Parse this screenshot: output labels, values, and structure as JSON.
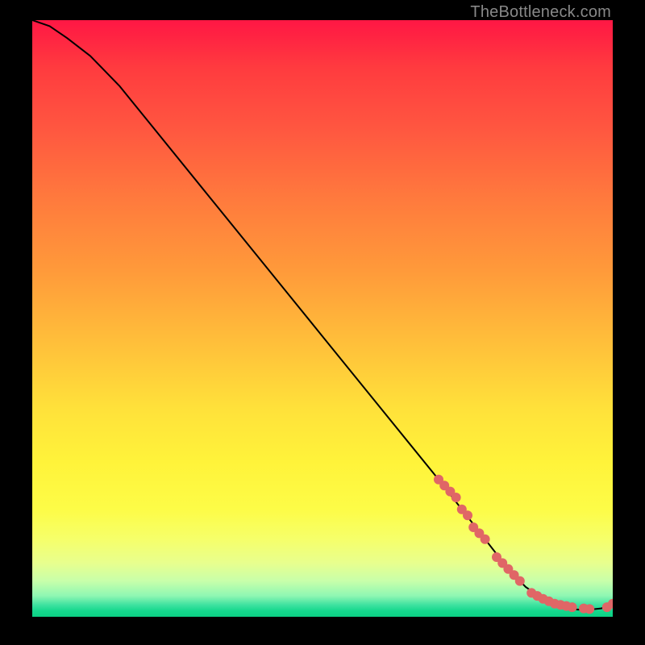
{
  "watermark": "TheBottleneck.com",
  "chart_data": {
    "type": "line",
    "title": "",
    "xlabel": "",
    "ylabel": "",
    "xlim": [
      0,
      100
    ],
    "ylim": [
      0,
      100
    ],
    "grid": false,
    "series": [
      {
        "name": "curve",
        "style": "line",
        "color": "#000000",
        "x": [
          0,
          3,
          6,
          10,
          15,
          20,
          30,
          40,
          50,
          60,
          70,
          78,
          82,
          85,
          88,
          90,
          92,
          94,
          96,
          98,
          100
        ],
        "y": [
          100,
          99,
          97,
          94,
          89,
          83,
          71,
          59,
          47,
          35,
          23,
          13,
          8,
          5,
          3,
          2,
          1.5,
          1.2,
          1.2,
          1.4,
          2.2
        ]
      },
      {
        "name": "highlight-points",
        "style": "scatter",
        "color": "#e06666",
        "x": [
          70,
          71,
          72,
          73,
          74,
          75,
          76,
          77,
          78,
          80,
          81,
          82,
          83,
          84,
          86,
          87,
          88,
          89,
          90,
          91,
          92,
          93,
          95,
          96,
          99,
          100
        ],
        "y": [
          23,
          22,
          21,
          20,
          18,
          17,
          15,
          14,
          13,
          10,
          9,
          8,
          7,
          6,
          4,
          3.5,
          3,
          2.6,
          2.2,
          2,
          1.8,
          1.6,
          1.4,
          1.3,
          1.6,
          2.2
        ]
      }
    ]
  }
}
